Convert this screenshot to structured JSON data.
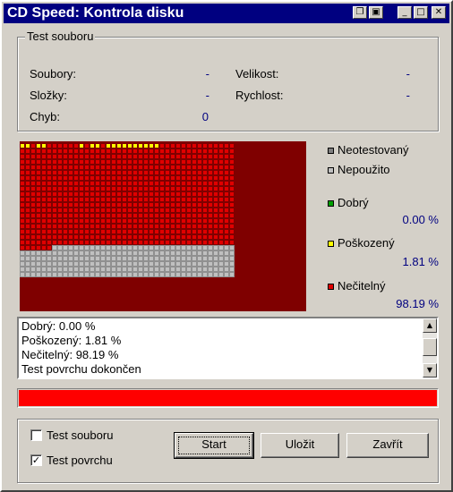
{
  "window": {
    "title": "CD Speed: Kontrola disku",
    "icons": [
      "copy-icon",
      "save-icon",
      "minimize-icon",
      "maximize-icon",
      "close-icon"
    ]
  },
  "file_test": {
    "legend": "Test souboru",
    "files_label": "Soubory:",
    "files_value": "-",
    "folders_label": "Složky:",
    "folders_value": "-",
    "errors_label": "Chyb:",
    "errors_value": "0",
    "size_label": "Velikost:",
    "size_value": "-",
    "speed_label": "Rychlost:",
    "speed_value": "-"
  },
  "surface_map": {
    "cols": 40,
    "rows": 25,
    "columns_tested": 40,
    "rows_unreadable": 19,
    "rows_unused": 6,
    "damaged_cells_row0": [
      0,
      1,
      3,
      4,
      11,
      13,
      14,
      16,
      17,
      18,
      19,
      20,
      21,
      22,
      23,
      24,
      25
    ],
    "unreadable_unused_cells_row19": [
      0,
      1,
      2,
      3,
      4,
      5
    ],
    "colors": {
      "untested": "#808080",
      "unused": "#c0c0c0",
      "good": "#00a000",
      "damaged": "#ffff00",
      "unreadable": "#e00000",
      "background": "#7f0000",
      "grid": "#7f0000"
    }
  },
  "legend": {
    "untested": "Neotestovaný",
    "unused": "Nepoužito",
    "good": "Dobrý",
    "good_pct": "0.00 %",
    "damaged": "Poškozený",
    "damaged_pct": "1.81 %",
    "unreadable": "Nečitelný",
    "unreadable_pct": "98.19 %"
  },
  "log": {
    "lines": [
      "Dobrý: 0.00 %",
      "Poškozený: 1.81 %",
      "Nečitelný: 98.19 %",
      "Test povrchu dokončen"
    ]
  },
  "progress": {
    "value_pct": 100,
    "color": "#ff0000"
  },
  "options": {
    "file_test_label": "Test souboru",
    "file_test_checked": false,
    "surface_test_label": "Test povrchu",
    "surface_test_checked": true
  },
  "buttons": {
    "start": "Start",
    "save": "Uložit",
    "close": "Zavřít"
  }
}
